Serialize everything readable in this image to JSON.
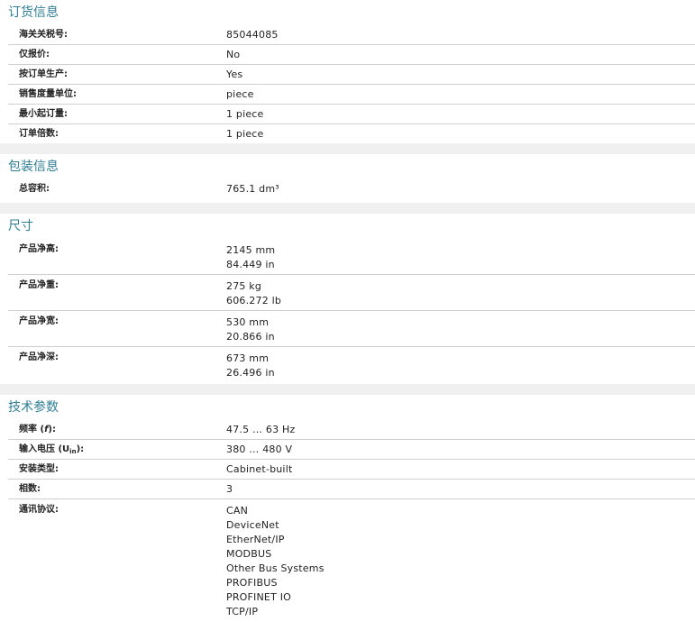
{
  "ordering": {
    "title": "订货信息",
    "rows": [
      {
        "label": "海关关税号:",
        "values": [
          "85044085"
        ]
      },
      {
        "label": "仅报价:",
        "values": [
          "No"
        ]
      },
      {
        "label": "按订单生产:",
        "values": [
          "Yes"
        ]
      },
      {
        "label": "销售度量单位:",
        "values": [
          "piece"
        ]
      },
      {
        "label": "最小起订量:",
        "values": [
          "1 piece"
        ]
      },
      {
        "label": "订单倍数:",
        "values": [
          "1 piece"
        ]
      }
    ]
  },
  "packaging": {
    "title": "包装信息",
    "rows": [
      {
        "label": "总容积:",
        "values": [
          "765.1 dm³"
        ]
      }
    ]
  },
  "dimensions": {
    "title": "尺寸",
    "rows": [
      {
        "label": "产品净高:",
        "values": [
          "2145 mm",
          "84.449 in"
        ]
      },
      {
        "label": "产品净重:",
        "values": [
          "275 kg",
          "606.272 lb"
        ]
      },
      {
        "label": "产品净宽:",
        "values": [
          "530 mm",
          "20.866 in"
        ]
      },
      {
        "label": "产品净深:",
        "values": [
          "673 mm",
          "26.496 in"
        ]
      }
    ]
  },
  "technical": {
    "title": "技术参数",
    "rows": [
      {
        "label_main": "频率 (",
        "label_italic": "f",
        "label_end": "):",
        "values": [
          "47.5 … 63 Hz"
        ]
      },
      {
        "label_main": "输入电压 (U",
        "label_sub": "in",
        "label_end": "):",
        "values": [
          "380 … 480 V"
        ]
      },
      {
        "label": "安装类型:",
        "values": [
          "Cabinet-built"
        ]
      },
      {
        "label": "相数:",
        "values": [
          "3"
        ]
      },
      {
        "label": "通讯协议:",
        "values": [
          "CAN",
          "DeviceNet",
          "EtherNet/IP",
          "MODBUS",
          "Other Bus Systems",
          "PROFIBUS",
          "PROFINET IO",
          "TCP/IP"
        ]
      }
    ]
  }
}
